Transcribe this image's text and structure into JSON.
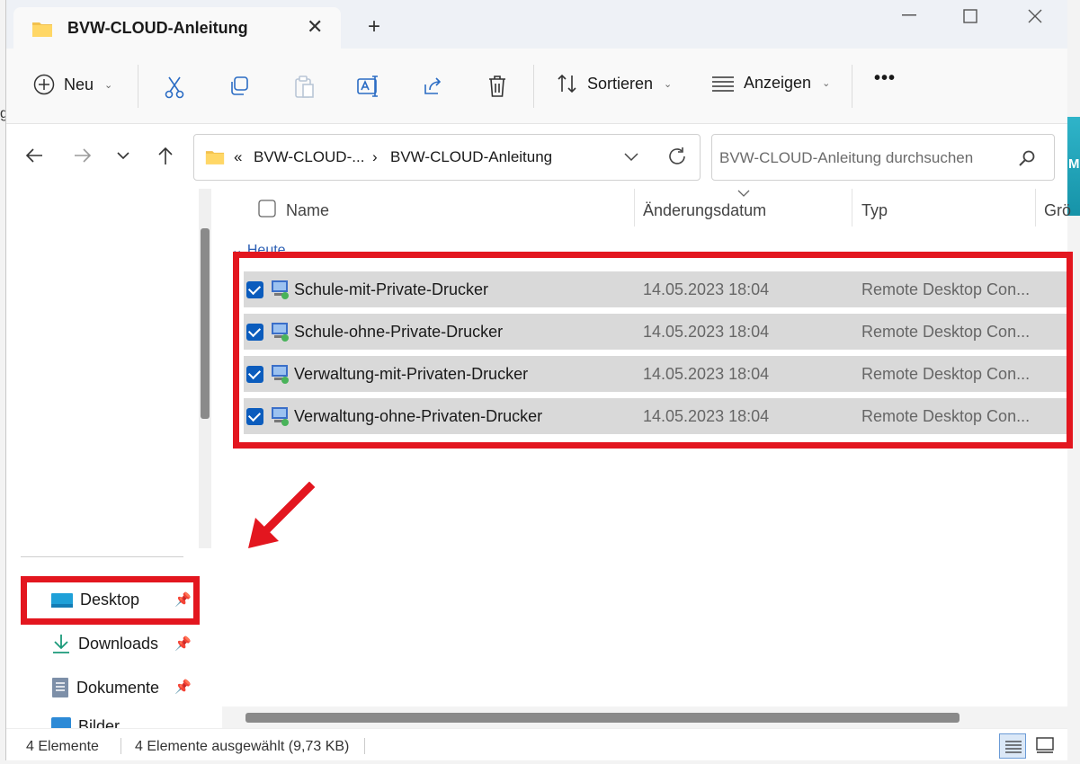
{
  "window": {
    "tab_title": "BVW-CLOUD-Anleitung",
    "close_tab": "✕",
    "new_tab": "+"
  },
  "background": {
    "left_letter": "g",
    "right_letter": "M"
  },
  "toolbar": {
    "new_label": "Neu",
    "sort_label": "Sortieren",
    "view_label": "Anzeigen",
    "more_label": "•••"
  },
  "address": {
    "prefix": "«",
    "crumb1": "BVW-CLOUD-...",
    "crumb_sep": "›",
    "crumb2": "BVW-CLOUD-Anleitung"
  },
  "search": {
    "placeholder": "BVW-CLOUD-Anleitung durchsuchen"
  },
  "columns": {
    "name": "Name",
    "date": "Änderungsdatum",
    "type": "Typ",
    "size": "Grö"
  },
  "group_label": "Heute",
  "files": [
    {
      "name": "Schule-mit-Private-Drucker",
      "date": "14.05.2023 18:04",
      "type": "Remote Desktop Con..."
    },
    {
      "name": "Schule-ohne-Private-Drucker",
      "date": "14.05.2023 18:04",
      "type": "Remote Desktop Con..."
    },
    {
      "name": "Verwaltung-mit-Privaten-Drucker",
      "date": "14.05.2023 18:04",
      "type": "Remote Desktop Con..."
    },
    {
      "name": "Verwaltung-ohne-Privaten-Drucker",
      "date": "14.05.2023 18:04",
      "type": "Remote Desktop Con..."
    }
  ],
  "sidebar": {
    "items": [
      {
        "label": "Desktop"
      },
      {
        "label": "Downloads"
      },
      {
        "label": "Dokumente"
      },
      {
        "label": "Bilder"
      }
    ]
  },
  "status": {
    "count": "4 Elemente",
    "selected": "4 Elemente ausgewählt (9,73 KB)"
  },
  "colors": {
    "highlight_red": "#e3161f",
    "selection_blue": "#0b5cbd",
    "row_selected": "#d9d9d9"
  }
}
